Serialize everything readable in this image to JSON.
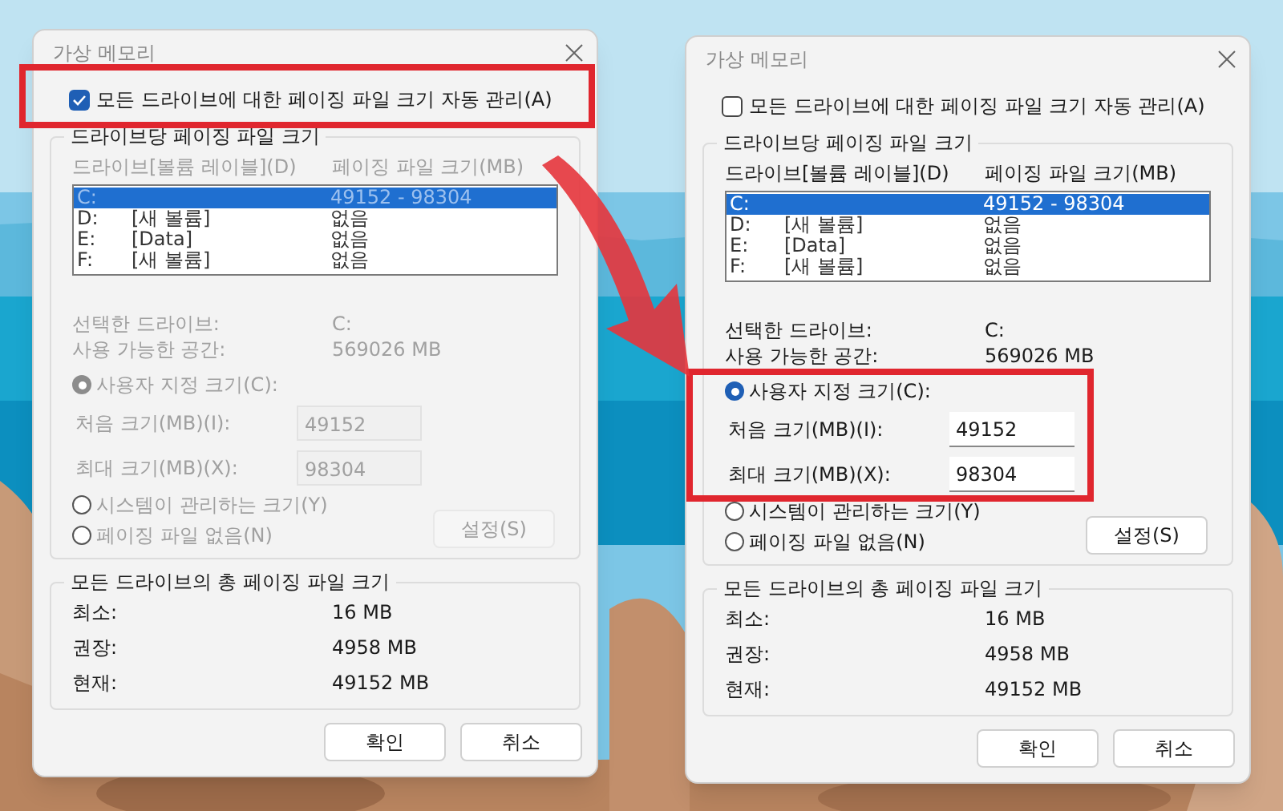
{
  "dialogs": [
    {
      "title": "가상 메모리",
      "auto_manage": {
        "label": "모든 드라이브에 대한 페이징 파일 크기 자동 관리(A)",
        "checked": true
      },
      "per_drive": {
        "title": "드라이브당 페이징 파일 크기",
        "columns": [
          "드라이브[볼륨 레이블](D)",
          "페이징 파일 크기(MB)"
        ],
        "drives": [
          {
            "drive": "C:",
            "size": "49152 - 98304",
            "selected": true
          },
          {
            "drive": "D:",
            "label": "[새 볼륨]",
            "size": "없음",
            "selected": false
          },
          {
            "drive": "E:",
            "label": "[Data]",
            "size": "없음",
            "selected": false
          },
          {
            "drive": "F:",
            "label": "[새 볼륨]",
            "size": "없음",
            "selected": false
          }
        ],
        "selected_drive_label": "선택한 드라이브:",
        "selected_drive": "C:",
        "free_space_label": "사용 가능한 공간:",
        "free_space": "569026 MB",
        "options": [
          {
            "label": "사용자 지정 크기(C):",
            "selected": true
          },
          {
            "label": "시스템이 관리하는 크기(Y)",
            "selected": false
          },
          {
            "label": "페이징 파일 없음(N)",
            "selected": false
          }
        ],
        "initial_label": "처음 크기(MB)(I):",
        "initial": "49152",
        "max_label": "최대 크기(MB)(X):",
        "max": "98304",
        "set_button": "설정(S)"
      },
      "totals": {
        "title": "모든 드라이브의 총 페이징 파일 크기",
        "rows": [
          {
            "label": "최소:",
            "value": "16 MB"
          },
          {
            "label": "권장:",
            "value": "4958 MB"
          },
          {
            "label": "현재:",
            "value": "49152 MB"
          }
        ]
      },
      "buttons": [
        "확인",
        "취소"
      ]
    },
    {
      "title": "가상 메모리",
      "auto_manage": {
        "label": "모든 드라이브에 대한 페이징 파일 크기 자동 관리(A)",
        "checked": false
      },
      "per_drive": {
        "title": "드라이브당 페이징 파일 크기",
        "columns": [
          "드라이브[볼륨 레이블](D)",
          "페이징 파일 크기(MB)"
        ],
        "drives": [
          {
            "drive": "C:",
            "size": "49152 - 98304",
            "selected": true
          },
          {
            "drive": "D:",
            "label": "[새 볼륨]",
            "size": "없음",
            "selected": false
          },
          {
            "drive": "E:",
            "label": "[Data]",
            "size": "없음",
            "selected": false
          },
          {
            "drive": "F:",
            "label": "[새 볼륨]",
            "size": "없음",
            "selected": false
          }
        ],
        "selected_drive_label": "선택한 드라이브:",
        "selected_drive": "C:",
        "free_space_label": "사용 가능한 공간:",
        "free_space": "569026 MB",
        "options": [
          {
            "label": "사용자 지정 크기(C):",
            "selected": true
          },
          {
            "label": "시스템이 관리하는 크기(Y)",
            "selected": false
          },
          {
            "label": "페이징 파일 없음(N)",
            "selected": false
          }
        ],
        "initial_label": "처음 크기(MB)(I):",
        "initial": "49152",
        "max_label": "최대 크기(MB)(X):",
        "max": "98304",
        "set_button": "설정(S)"
      },
      "totals": {
        "title": "모든 드라이브의 총 페이징 파일 크기",
        "rows": [
          {
            "label": "최소:",
            "value": "16 MB"
          },
          {
            "label": "권장:",
            "value": "4958 MB"
          },
          {
            "label": "현재:",
            "value": "49152 MB"
          }
        ]
      },
      "buttons": [
        "확인",
        "취소"
      ]
    }
  ]
}
